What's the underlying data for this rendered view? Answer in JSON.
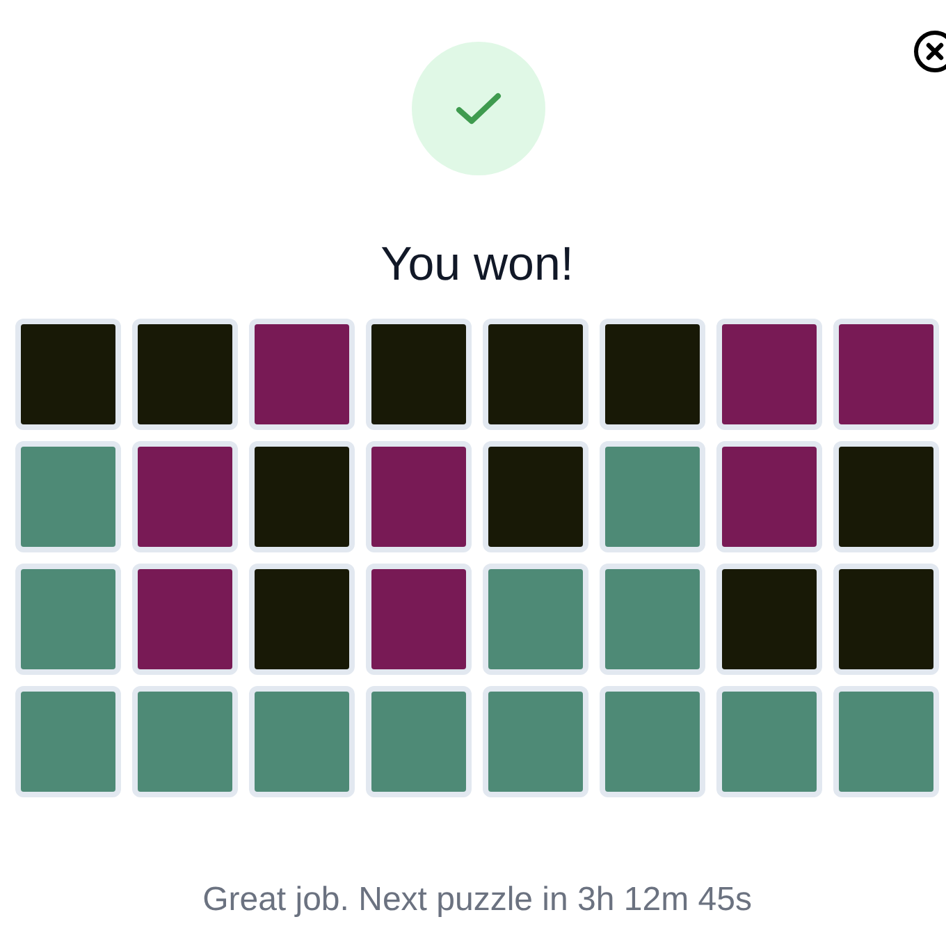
{
  "title": "You won!",
  "grid": [
    [
      {
        "color": "#181906"
      },
      {
        "color": "#181906"
      },
      {
        "color": "#781a55"
      },
      {
        "color": "#181906"
      },
      {
        "color": "#181906"
      },
      {
        "color": "#181906"
      },
      {
        "color": "#781a55"
      },
      {
        "color": "#781a55"
      }
    ],
    [
      {
        "color": "#4e8a76"
      },
      {
        "color": "#781a55"
      },
      {
        "color": "#181906"
      },
      {
        "color": "#781a55"
      },
      {
        "color": "#181906"
      },
      {
        "color": "#4e8a76"
      },
      {
        "color": "#781a55"
      },
      {
        "color": "#181906"
      }
    ],
    [
      {
        "color": "#4e8a76"
      },
      {
        "color": "#781a55"
      },
      {
        "color": "#181906"
      },
      {
        "color": "#781a55"
      },
      {
        "color": "#4e8a76"
      },
      {
        "color": "#4e8a76"
      },
      {
        "color": "#181906"
      },
      {
        "color": "#181906"
      }
    ],
    [
      {
        "color": "#4e8a76"
      },
      {
        "color": "#4e8a76"
      },
      {
        "color": "#4e8a76"
      },
      {
        "color": "#4e8a76"
      },
      {
        "color": "#4e8a76"
      },
      {
        "color": "#4e8a76"
      },
      {
        "color": "#4e8a76"
      },
      {
        "color": "#4e8a76"
      }
    ]
  ],
  "footer": "Great job. Next puzzle in 3h 12m 45s"
}
